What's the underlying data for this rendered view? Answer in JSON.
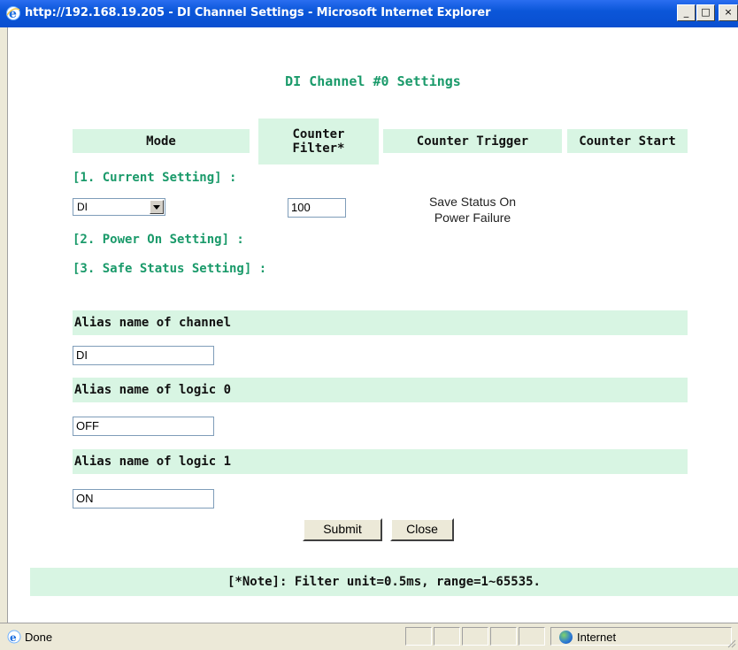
{
  "window": {
    "title": "http://192.168.19.205 - DI Channel Settings - Microsoft Internet Explorer",
    "minimize": "_",
    "maximize": "□",
    "close": "×"
  },
  "page": {
    "title": "DI Channel #0 Settings",
    "headers": {
      "mode": "Mode",
      "counter_filter": "Counter Filter*",
      "counter_trigger": "Counter Trigger",
      "counter_start": "Counter Start"
    },
    "current_setting": "[1. Current Setting] :",
    "power_on_setting": "[2. Power On Setting] :",
    "safe_status_setting": "[3. Safe Status Setting] :",
    "mode_select_value": "DI",
    "counter_filter_value": "100",
    "save_status_line1": "Save Status On",
    "save_status_line2": "Power  Failure",
    "alias_channel_label": "Alias name of  channel",
    "alias_channel_value": "DI",
    "alias_logic0_label": "Alias name of logic 0",
    "alias_logic0_value": "OFF",
    "alias_logic1_label": "Alias name of logic 1",
    "alias_logic1_value": "ON",
    "submit_label": "Submit",
    "close_label": "Close",
    "note": "[*Note]: Filter unit=0.5ms, range=1~65535."
  },
  "statusbar": {
    "status": "Done",
    "zone": "Internet"
  },
  "colors": {
    "accent_green": "#1a9a6a",
    "header_bg": "#d8f5e3",
    "titlebar_blue": "#0b56d9"
  }
}
